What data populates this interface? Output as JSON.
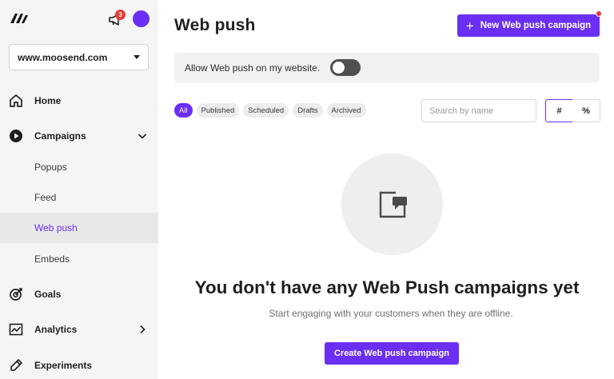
{
  "sidebar": {
    "notification_count": "3",
    "site_select": {
      "value": "www.moosend.com"
    },
    "items": [
      {
        "key": "home",
        "label": "Home"
      },
      {
        "key": "campaigns",
        "label": "Campaigns"
      },
      {
        "key": "goals",
        "label": "Goals"
      },
      {
        "key": "analytics",
        "label": "Analytics"
      },
      {
        "key": "experiments",
        "label": "Experiments"
      }
    ],
    "campaign_subitems": [
      {
        "label": "Popups"
      },
      {
        "label": "Feed"
      },
      {
        "label": "Web push",
        "active": true
      },
      {
        "label": "Embeds"
      }
    ]
  },
  "header": {
    "title": "Web push",
    "new_button_label": "New Web push campaign"
  },
  "allow_bar": {
    "label": "Allow Web push on my website.",
    "enabled": false
  },
  "filters": {
    "chips": [
      "All",
      "Published",
      "Scheduled",
      "Drafts",
      "Archived"
    ],
    "active": "All",
    "search_placeholder": "Search by name",
    "units": [
      "#",
      "%"
    ],
    "active_unit": "#"
  },
  "empty_state": {
    "title": "You don't have any Web Push campaigns yet",
    "subtitle": "Start engaging with your customers when they are offline.",
    "button_label": "Create Web push campaign"
  },
  "colors": {
    "accent": "#6b2ff3",
    "badge": "#e7393a",
    "sidebar_bg": "#f5f5f5"
  },
  "icons": {
    "logo": "moosend-logo-icon",
    "notifications": "megaphone-icon",
    "home": "home-icon",
    "campaigns": "play-circle-icon",
    "goals": "target-icon",
    "analytics": "line-chart-icon",
    "experiments": "flask-icon",
    "empty": "browser-push-icon"
  }
}
